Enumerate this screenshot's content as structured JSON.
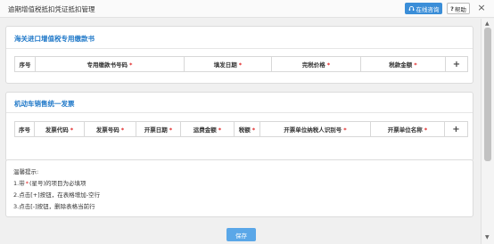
{
  "window": {
    "title": "逾期增值税抵扣凭证抵扣管理",
    "online_consult_label": "在线咨询",
    "help_label": "帮助",
    "close_glyph": "×"
  },
  "customs_section": {
    "title": "海关进口增值税专用缴款书",
    "columns": [
      "序号",
      "专用缴款书号码",
      "填发日期",
      "完税价格",
      "税款金额"
    ],
    "required": [
      false,
      true,
      true,
      true,
      true
    ],
    "add_glyph": "+"
  },
  "vehicle_section": {
    "title": "机动车销售统一发票",
    "columns": [
      "序号",
      "发票代码",
      "发票号码",
      "开票日期",
      "运费金额",
      "税额",
      "开票单位纳税人识别号",
      "开票单位名称"
    ],
    "required": [
      false,
      true,
      true,
      true,
      true,
      true,
      true,
      true
    ],
    "add_glyph": "+"
  },
  "tips": {
    "heading": "温馨提示:",
    "line1_prefix": "1.带",
    "line1_star": "*",
    "line1_suffix": "(星号)的项目为必填项",
    "line2": "2.点击[+]按钮，在表格增加-空行",
    "line3": "3.点击[-]按钮，删除表格当前行"
  },
  "actions": {
    "save_label": "保存"
  },
  "required_mark": "*",
  "colors": {
    "accent": "#1f78c8",
    "button": "#3b8ed8",
    "save_button": "#5aa7e8",
    "required": "#e02020"
  }
}
